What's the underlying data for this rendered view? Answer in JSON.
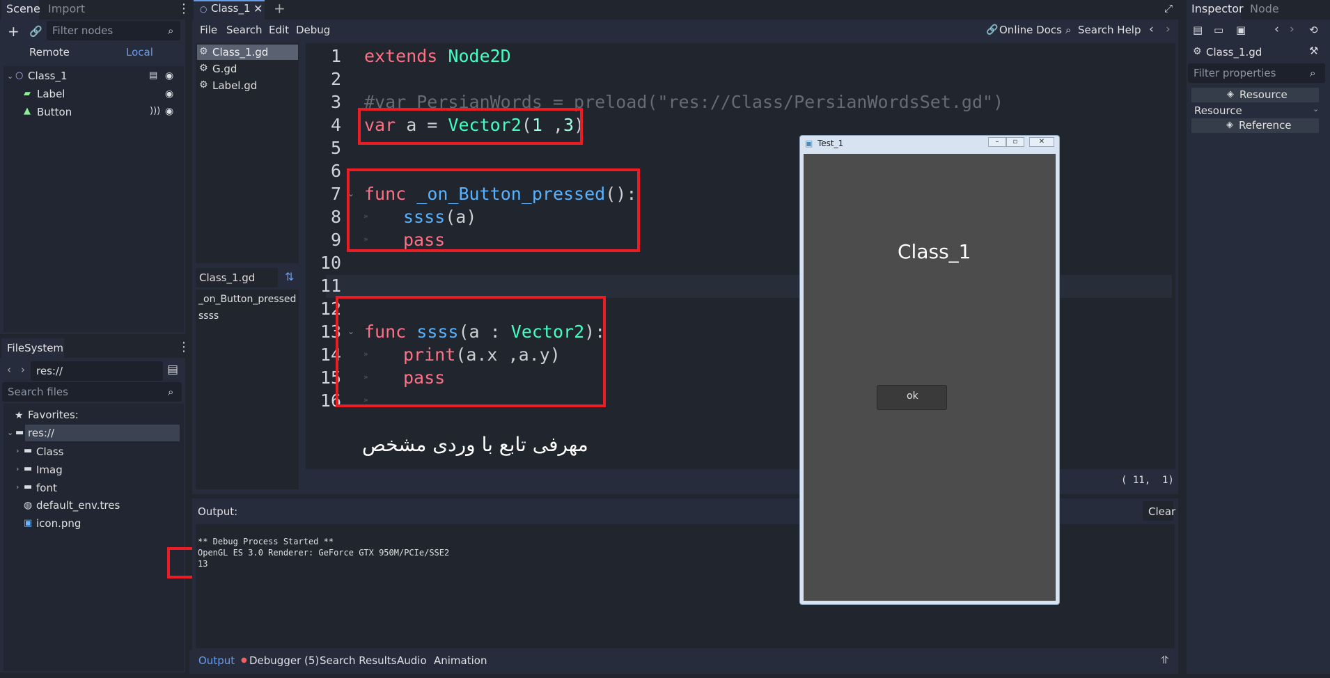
{
  "scene_dock": {
    "tabs": [
      "Scene",
      "Import"
    ],
    "filter_placeholder": "Filter nodes",
    "remote_label": "Remote",
    "local_label": "Local",
    "nodes": [
      "Class_1",
      "Label",
      "Button"
    ]
  },
  "filesystem": {
    "title": "FileSystem",
    "path": "res://",
    "search_placeholder": "Search files",
    "favorites": "Favorites:",
    "root": "res://",
    "items": [
      "Class",
      "Imag",
      "font",
      "default_env.tres",
      "icon.png"
    ]
  },
  "editor": {
    "tab": "Class_1",
    "menus": [
      "File",
      "Search",
      "Edit",
      "Debug"
    ],
    "online_docs": "Online Docs",
    "search_help": "Search Help",
    "scripts": [
      "Class_1.gd",
      "G.gd",
      "Label.gd"
    ],
    "methods_title": "Class_1.gd",
    "methods": [
      "_on_Button_pressed",
      "ssss"
    ],
    "line_numbers": [
      "1",
      "2",
      "3",
      "4",
      "5",
      "6",
      "7",
      "8",
      "9",
      "10",
      "11",
      "12",
      "13",
      "14",
      "15",
      "16"
    ],
    "code": {
      "l1_kw": "extends",
      "l1_ty": "Node2D",
      "l3_comment": "#var PersianWords = preload(\"res://Class/PersianWordsSet.gd\")",
      "l4_kw": "var",
      "l4_txt": " a = ",
      "l4_ty": "Vector2",
      "l4_open": "(",
      "l4_n1": "1",
      "l4_sep": " ,",
      "l4_n2": "3",
      "l4_close": ")",
      "l7_kw": "func",
      "l7_fn": "_on_Button_pressed",
      "l7_rest": "():",
      "l8_fn": "ssss",
      "l8_rest": "(a)",
      "l9_kw": "pass",
      "l13_kw": "func",
      "l13_fn": "ssss",
      "l13_a": "(a : ",
      "l13_ty": "Vector2",
      "l13_b": "):",
      "l14_kw": "print",
      "l14_rest": "(a.x ,a.y)",
      "l15_kw": "pass"
    },
    "persian_caption": "مهرفی تابع با وردی مشخص",
    "cursor_pos": "( 11,  1)"
  },
  "output": {
    "title": "Output:",
    "clear": "Clear",
    "lines": [
      "** Debug Process Started **",
      "OpenGL ES 3.0 Renderer: GeForce GTX 950M/PCIe/SSE2",
      "13"
    ]
  },
  "bottom_tabs": [
    "Output",
    "Debugger (5)",
    "Search Results",
    "Audio",
    "Animation"
  ],
  "game_window": {
    "title": "Test_1",
    "label": "Class_1",
    "button": "ok"
  },
  "inspector": {
    "tabs": [
      "Inspector",
      "Node"
    ],
    "object": "Class_1.gd",
    "filter_placeholder": "Filter properties",
    "resource_btn": "Resource",
    "resource_label": "Resource",
    "reference_btn": "Reference"
  },
  "colors": {
    "accent": "#699ce8",
    "keyword": "#ff7085",
    "type": "#42ffc2",
    "function": "#57b3ff",
    "annotation_red": "#ec1c24"
  }
}
